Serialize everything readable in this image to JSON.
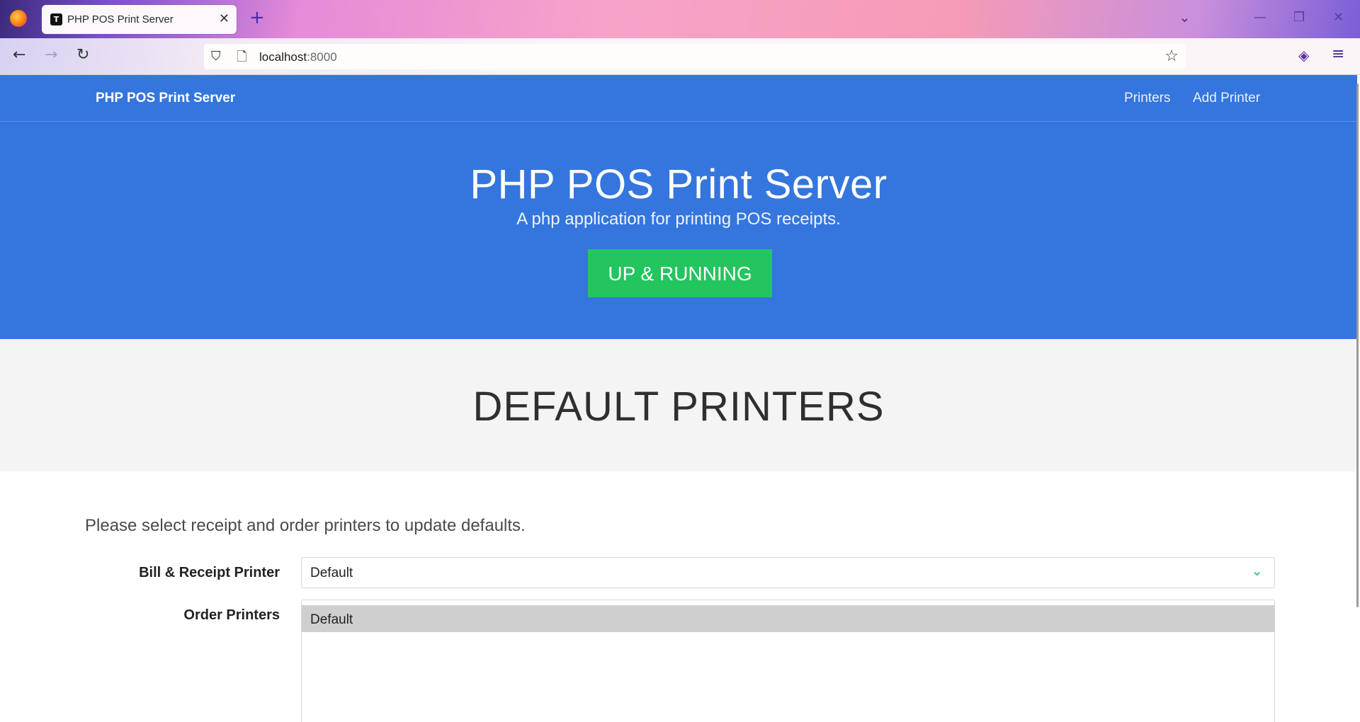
{
  "browser": {
    "tab_title": "PHP POS Print Server",
    "tab_favicon": "T",
    "tab_close": "✕",
    "new_tab": "+",
    "url_host": "localhost",
    "url_port": ":8000",
    "icons": {
      "firefox": "firefox-logo-icon",
      "back": "←",
      "forward": "→",
      "reload": "↻",
      "shield": "⛉",
      "page": "🗋",
      "star": "☆",
      "tablist": "⌄",
      "minimize": "—",
      "restore": "❐",
      "close": "✕",
      "pocket": "◈",
      "menu": "≡"
    }
  },
  "site": {
    "brand": "PHP POS Print Server",
    "nav": [
      "Printers",
      "Add Printer"
    ],
    "hero": {
      "title": "PHP POS Print Server",
      "subtitle": "A php application for printing POS receipts.",
      "status": "UP & RUNNING"
    },
    "section_title": "DEFAULT PRINTERS",
    "intro": "Please select receipt and order printers to update defaults.",
    "form": {
      "bill_label": "Bill & Receipt Printer",
      "bill_value": "Default",
      "order_label": "Order Printers",
      "order_options": [
        "Default"
      ],
      "order_selected": "Default"
    }
  },
  "colors": {
    "primary": "#3476dd",
    "success": "#22c55e",
    "section_bg": "#f4f4f4",
    "chevron": "#2fb39a"
  }
}
